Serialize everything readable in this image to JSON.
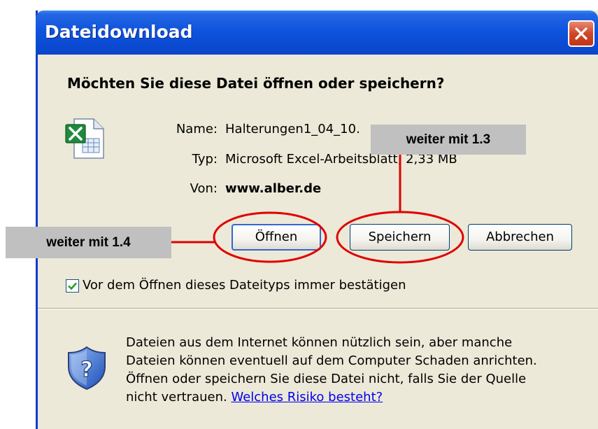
{
  "window": {
    "title": "Dateidownload",
    "close_icon": "close-icon"
  },
  "prompt": {
    "question": "Möchten Sie diese Datei öffnen oder speichern?"
  },
  "file": {
    "icon": "excel-file-icon",
    "name_label": "Name:",
    "name_value": "Halterungen1_04_10.",
    "type_label": "Typ:",
    "type_value": "Microsoft Excel-Arbeitsblatt, 2,33 MB",
    "from_label": "Von:",
    "from_value": "www.alber.de"
  },
  "buttons": {
    "open": "Öffnen",
    "save": "Speichern",
    "cancel": "Abbrechen"
  },
  "checkbox": {
    "label": "Vor dem Öffnen dieses Dateityps immer bestätigen",
    "checked": true
  },
  "warning": {
    "icon": "security-shield-icon",
    "line1": "Dateien aus dem Internet können nützlich sein, aber manche",
    "line2": "Dateien können eventuell auf dem Computer Schaden anrichten.",
    "line3": "Öffnen oder speichern Sie diese Datei nicht, falls Sie der Quelle",
    "line4_prefix": "nicht vertrauen.",
    "link": "Welches Risiko besteht?"
  },
  "annotations": {
    "save_callout": "weiter mit 1.3",
    "open_callout": "weiter mit 1.4",
    "color": "#e00000"
  }
}
